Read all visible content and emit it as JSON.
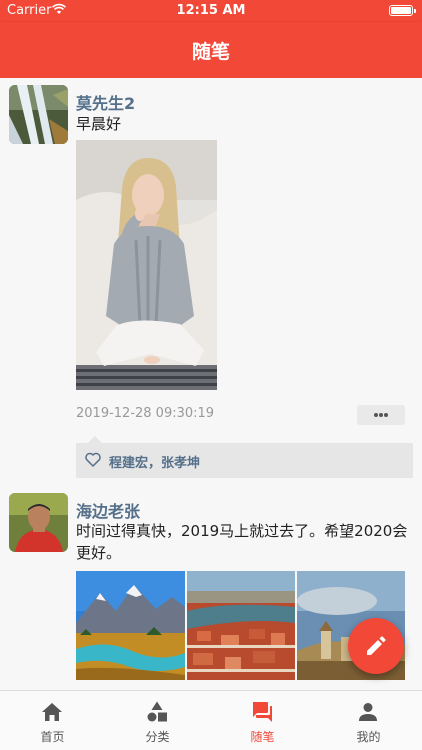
{
  "status_bar": {
    "carrier": "Carrier",
    "time": "12:15 AM"
  },
  "nav": {
    "title": "随笔"
  },
  "posts": [
    {
      "name": "莫先生2",
      "text": "早晨好",
      "time": "2019-12-28 09:30:19",
      "likes": "程建宏，张孝坤"
    },
    {
      "name": "海边老张",
      "text": "时间过得真快，2019马上就过去了。希望2020会更好。"
    }
  ],
  "tabs": [
    {
      "label": "首页",
      "icon": "home-icon",
      "active": false
    },
    {
      "label": "分类",
      "icon": "category-icon",
      "active": false
    },
    {
      "label": "随笔",
      "icon": "notes-icon",
      "active": true
    },
    {
      "label": "我的",
      "icon": "profile-icon",
      "active": false
    }
  ],
  "colors": {
    "accent": "#f24838",
    "name": "#55708a",
    "background": "#f7f7f7"
  }
}
